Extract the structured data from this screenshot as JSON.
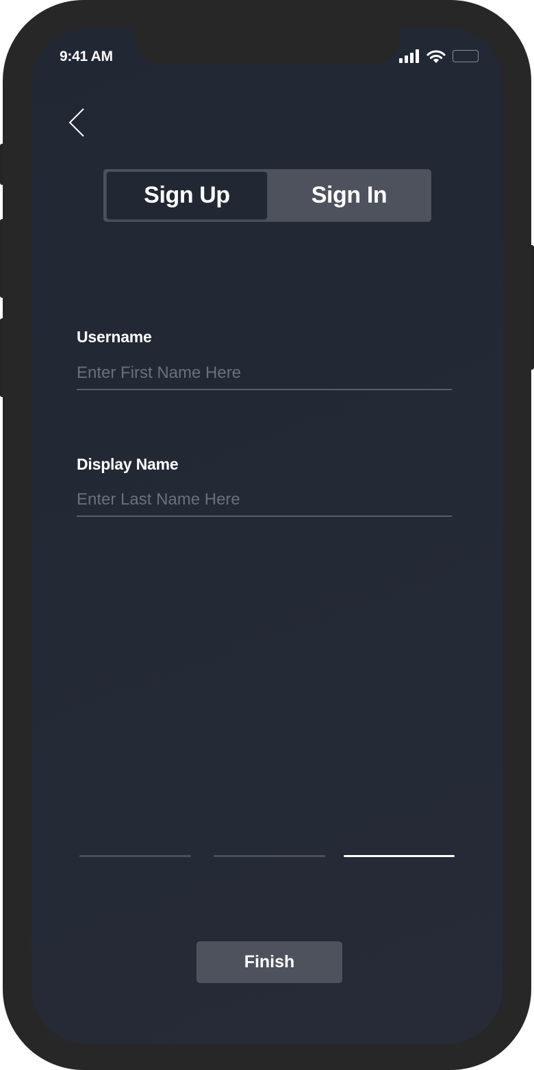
{
  "status_bar": {
    "time": "9:41 AM",
    "icons": [
      "cellular-signal-icon",
      "wifi-icon",
      "battery-icon"
    ]
  },
  "navigation": {
    "back_icon": "chevron-left-icon"
  },
  "auth_toggle": {
    "selected": "Sign Up",
    "options": [
      "Sign Up",
      "Sign In"
    ]
  },
  "form": {
    "username": {
      "label": "Username",
      "value": "",
      "placeholder": "Enter First Name Here"
    },
    "display_name": {
      "label": "Display Name",
      "value": "",
      "placeholder": "Enter Last Name Here"
    }
  },
  "progress": {
    "total_steps": 3,
    "current_step": 3
  },
  "actions": {
    "finish_label": "Finish"
  },
  "colors": {
    "background": "#232935",
    "device_frame": "#272727",
    "control_fill": "#4d525d",
    "selected_segment": "#212733",
    "text": "#ffffff",
    "placeholder": "#6b707a",
    "divider": "#5a5f69",
    "progress_active": "#ffffff",
    "progress_inactive": "#4a4f59"
  }
}
